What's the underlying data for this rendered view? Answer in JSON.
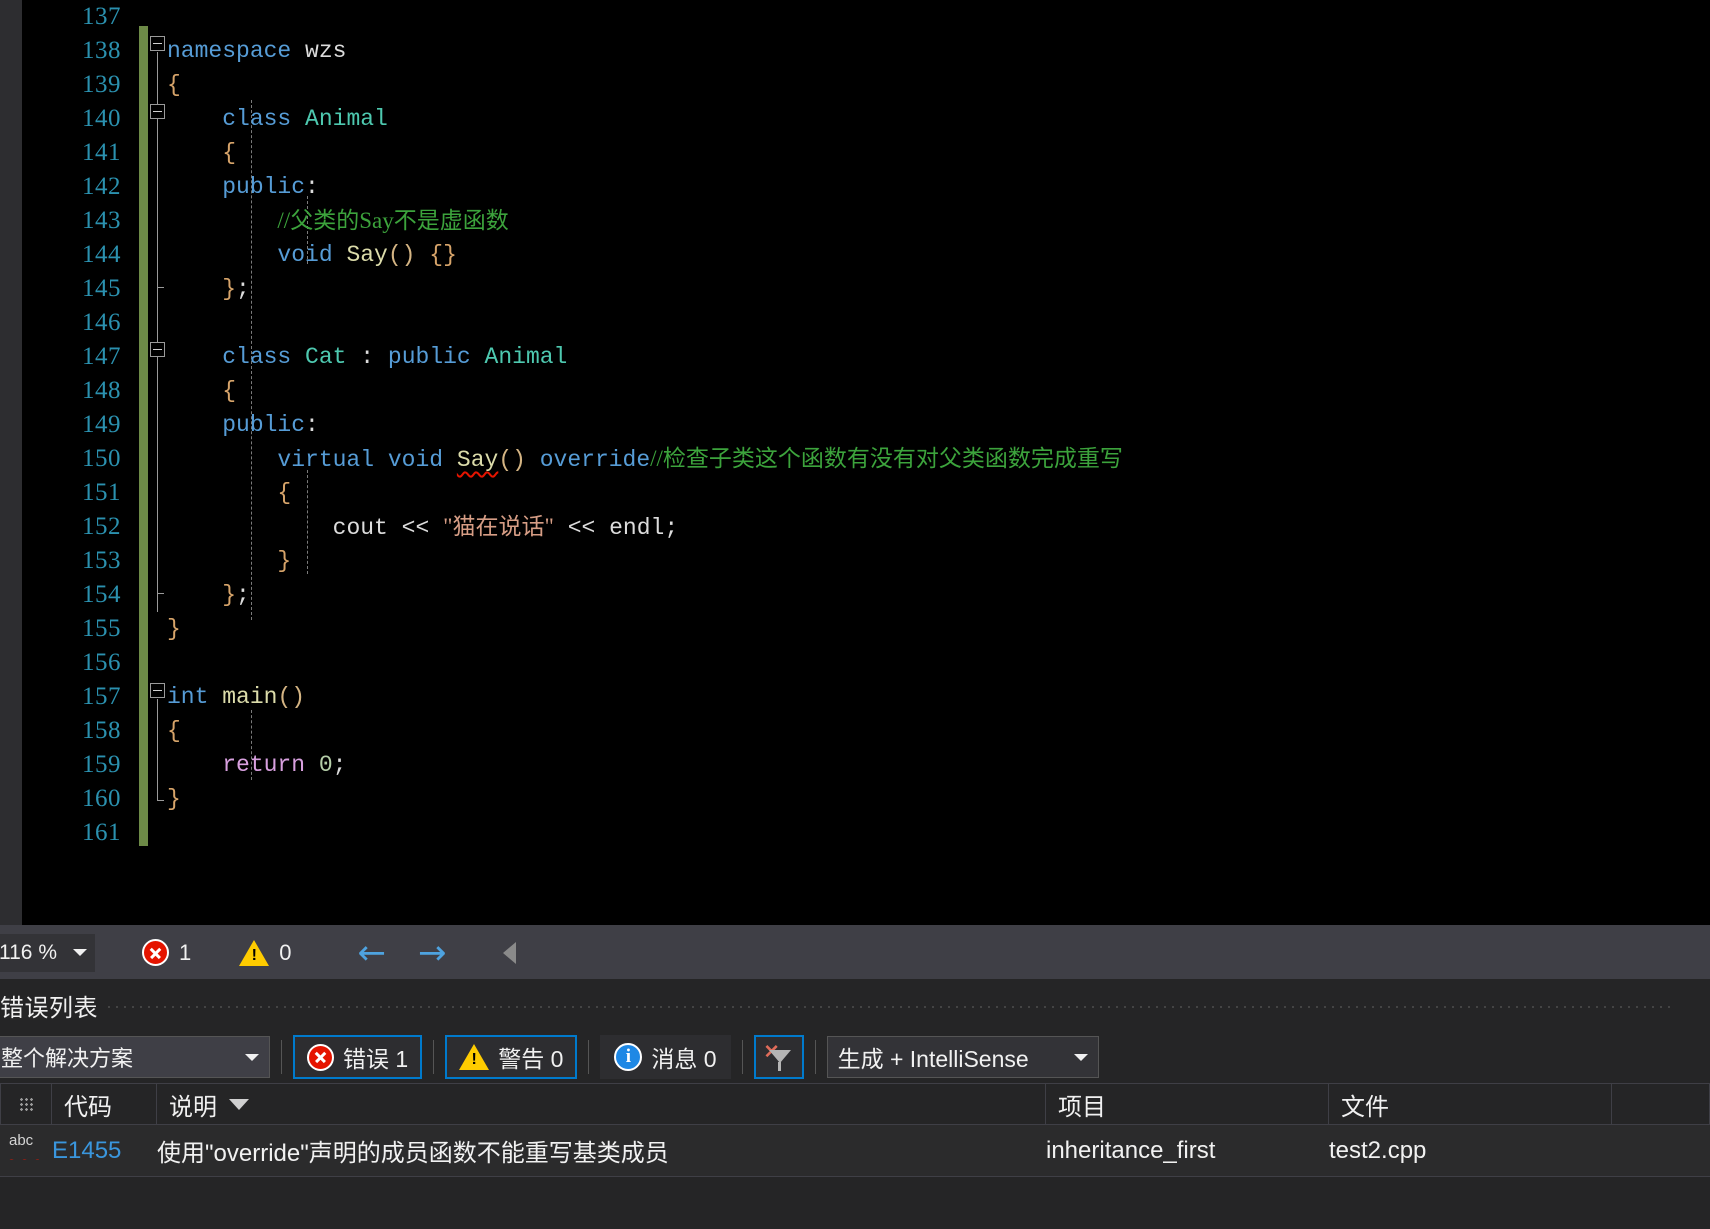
{
  "editor": {
    "language": "cpp",
    "first_line_number": 137,
    "lines": [
      {
        "n": 137,
        "text": ""
      },
      {
        "n": 138,
        "text": "namespace wzs"
      },
      {
        "n": 139,
        "text": "{"
      },
      {
        "n": 140,
        "text": "    class Animal"
      },
      {
        "n": 141,
        "text": "    {"
      },
      {
        "n": 142,
        "text": "    public:"
      },
      {
        "n": 143,
        "text": "        //父类的Say不是虚函数"
      },
      {
        "n": 144,
        "text": "        void Say() {}"
      },
      {
        "n": 145,
        "text": "    };"
      },
      {
        "n": 146,
        "text": ""
      },
      {
        "n": 147,
        "text": "    class Cat : public Animal"
      },
      {
        "n": 148,
        "text": "    {"
      },
      {
        "n": 149,
        "text": "    public:"
      },
      {
        "n": 150,
        "text": "        virtual void Say() override//检查子类这个函数有没有对父类函数完成重写"
      },
      {
        "n": 151,
        "text": "        {"
      },
      {
        "n": 152,
        "text": "            cout << \"猫在说话\" << endl;"
      },
      {
        "n": 153,
        "text": "        }"
      },
      {
        "n": 154,
        "text": "    };"
      },
      {
        "n": 155,
        "text": "}"
      },
      {
        "n": 156,
        "text": ""
      },
      {
        "n": 157,
        "text": "int main()"
      },
      {
        "n": 158,
        "text": "{"
      },
      {
        "n": 159,
        "text": "    return 0;"
      },
      {
        "n": 160,
        "text": "}"
      },
      {
        "n": 161,
        "text": ""
      }
    ],
    "tokens": {
      "kw_namespace": "namespace",
      "ns_name": "wzs",
      "kw_class": "class",
      "type_animal": "Animal",
      "type_cat": "Cat",
      "kw_public": "public",
      "kw_virtual": "virtual",
      "kw_void": "void",
      "kw_int": "int",
      "kw_return": "return",
      "fn_say": "Say",
      "fn_main": "main",
      "id_cout": "cout",
      "id_endl": "endl",
      "kw_override": "override",
      "num_zero": "0",
      "comment_143": "//父类的Say不是虚函数",
      "comment_150": "//检查子类这个函数有没有对父类函数完成重写",
      "string_152": "\"猫在说话\""
    },
    "squiggle_token": "Say"
  },
  "statusbar": {
    "zoom_level": "116 %",
    "error_count": "1",
    "warning_count": "0",
    "nav_back": "←",
    "nav_forward": "→"
  },
  "error_list": {
    "title": "错误列表",
    "scope_filter": "整个解决方案",
    "buttons": {
      "errors": "错误 1",
      "warnings": "警告 0",
      "messages": "消息 0"
    },
    "build_filter": "生成 + IntelliSense",
    "columns": [
      "代码",
      "说明",
      "项目",
      "文件"
    ],
    "rows": [
      {
        "icon": "abc-squiggle-icon",
        "code": "E1455",
        "description": "使用\"override\"声明的成员函数不能重写基类成员",
        "project": "inheritance_first",
        "file": "test2.cpp"
      }
    ]
  },
  "colors": {
    "editor_bg": "#000000",
    "panel_bg": "#252526",
    "statusbar_bg": "#3f3f46",
    "accent": "#007acc",
    "line_number": "#2b91af",
    "keyword": "#569cd6",
    "type": "#4ec9b0",
    "comment": "#3ca33c",
    "string": "#d69d85",
    "error_red": "#e51400",
    "warning_yellow": "#ffcc00",
    "change_bar_green": "#6d8a47"
  }
}
